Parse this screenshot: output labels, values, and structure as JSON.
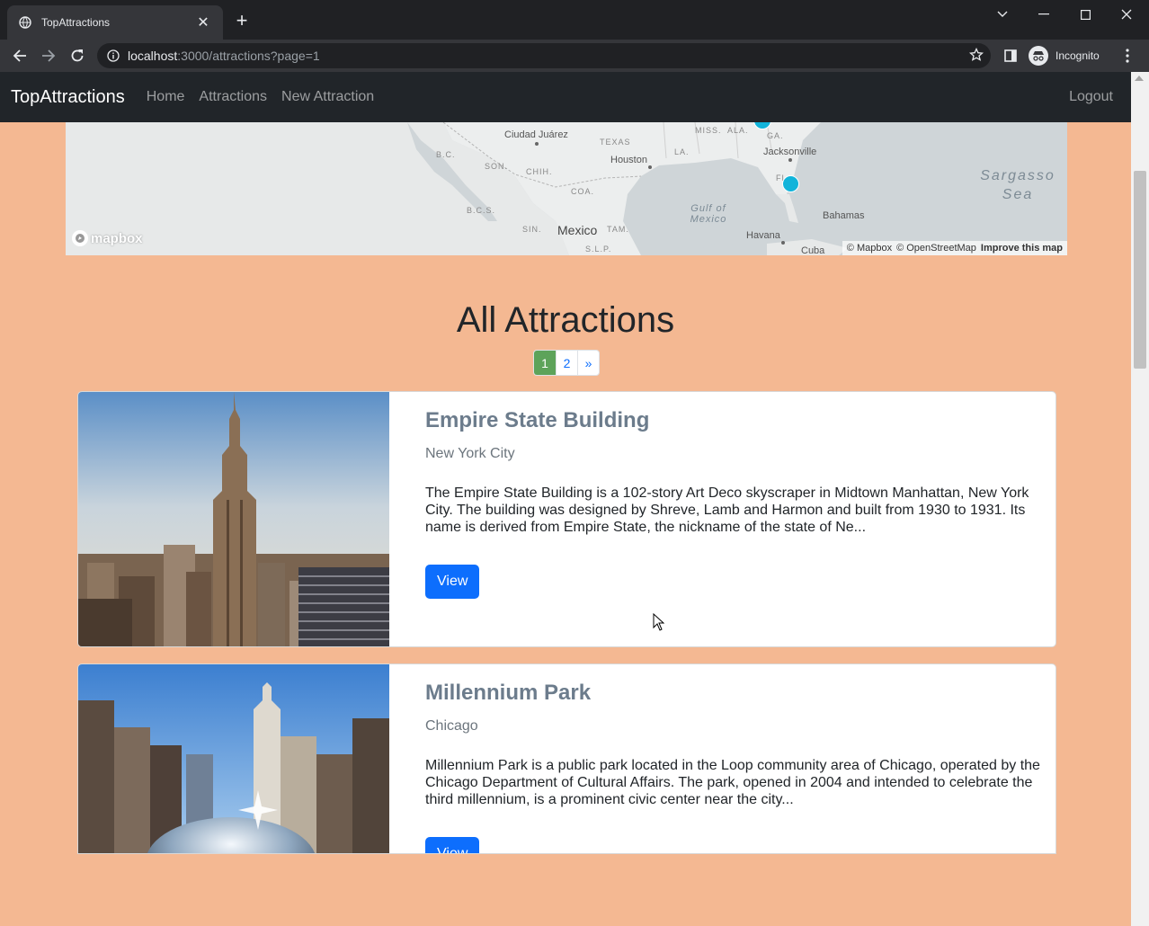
{
  "browser": {
    "tab_title": "TopAttractions",
    "new_tab_glyph": "+",
    "close_glyph": "✕",
    "url_host": "localhost",
    "url_rest": ":3000/attractions?page=1",
    "profile_label": "Incognito"
  },
  "navbar": {
    "brand": "TopAttractions",
    "links": [
      "Home",
      "Attractions",
      "New Attraction"
    ],
    "logout": "Logout"
  },
  "map": {
    "labels": {
      "ciudad_juarez": "Ciudad Juárez",
      "texas": "TEXAS",
      "miss": "MISS.",
      "ala": "ALA.",
      "ga": "GA.",
      "jacksonville": "Jacksonville",
      "bc": "B.C.",
      "son": "SON.",
      "chih": "CHIH.",
      "houston": "Houston",
      "la": "LA.",
      "coa": "COA.",
      "bcs": "B.C.S.",
      "gulf": "Gulf of\nMexico",
      "fl": "FL",
      "sargasso": "Sargasso\nSea",
      "bahamas": "Bahamas",
      "sin": "SIN.",
      "mexico": "Mexico",
      "tam": "TAM.",
      "slp": "S.L.P.",
      "havana": "Havana",
      "cuba": "Cuba"
    },
    "logo_text": "mapbox",
    "attribution": {
      "mapbox": "© Mapbox",
      "osm": "© OpenStreetMap",
      "improve": "Improve this map"
    },
    "cluster_color": "#11b4da"
  },
  "main": {
    "heading": "All Attractions",
    "pagination": {
      "items": [
        "1",
        "2",
        "»"
      ],
      "active_page": "1"
    },
    "attractions": [
      {
        "title": "Empire State Building",
        "location": "New York City",
        "description": "The Empire State Building is a 102-story Art Deco skyscraper in Midtown Manhattan, New York City. The building was designed by Shreve, Lamb and Harmon and built from 1930 to 1931. Its name is derived from Empire State, the nickname of the state of Ne...",
        "button": "View"
      },
      {
        "title": "Millennium Park",
        "location": "Chicago",
        "description": "Millennium Park is a public park located in the Loop community area of Chicago, operated by the Chicago Department of Cultural Affairs. The park, opened in 2004 and intended to celebrate the third millennium, is a prominent civic center near the city...",
        "button": "View"
      }
    ]
  },
  "colors": {
    "page_bg": "#f4b892",
    "navbar_bg": "#212529",
    "primary": "#0d6efd",
    "active_page": "#5da35a"
  }
}
